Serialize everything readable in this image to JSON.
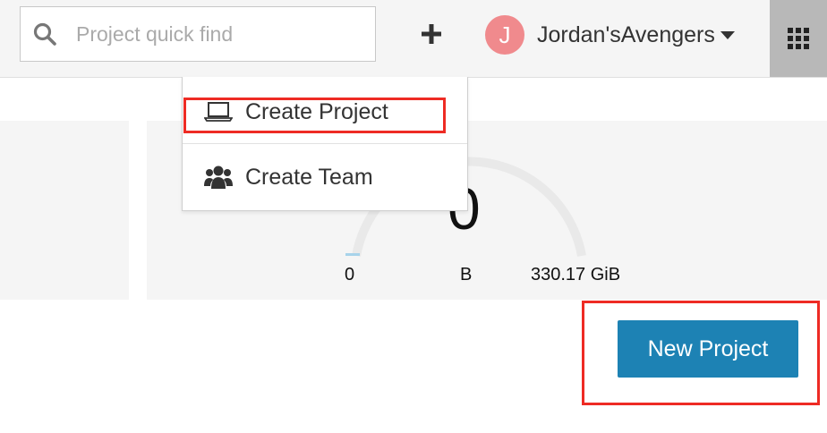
{
  "header": {
    "search": {
      "placeholder": "Project quick find",
      "icon": "search-icon"
    },
    "add_icon": "plus-icon",
    "org": {
      "avatar_initial": "J",
      "avatar_color": "#f08a8d",
      "name": "Jordan'sAvengers"
    },
    "apps_icon": "grid-icon"
  },
  "dropdown": {
    "items": [
      {
        "label": "Create Project",
        "icon": "laptop-icon"
      },
      {
        "label": "Create Team",
        "icon": "users-icon"
      }
    ]
  },
  "usage_gauge": {
    "value": "0",
    "min_label": "0",
    "unit_label": "B",
    "max_label": "330.17 GiB"
  },
  "new_project_button": {
    "label": "New Project",
    "color": "#1d82b4"
  },
  "annotation_color": "#ee2b24"
}
